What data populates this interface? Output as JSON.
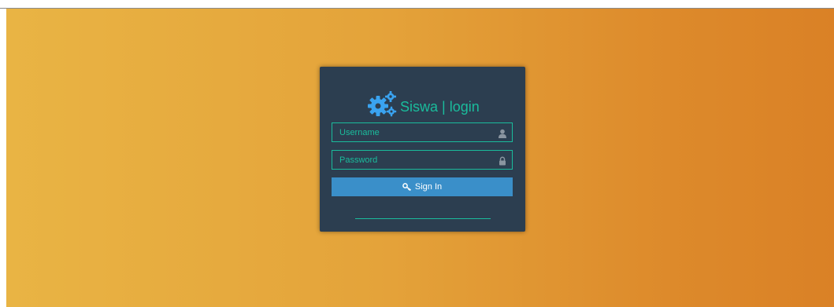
{
  "login": {
    "brand_title": "Siswa | login",
    "username_placeholder": "Username",
    "password_placeholder": "Password",
    "signin_label": "Sign In"
  },
  "colors": {
    "panel": "#2c3e50",
    "accent": "#1abc9c",
    "button": "#3a8fc9",
    "gears": "#3aa3f0",
    "background_start": "#e9b444",
    "background_end": "#da8126"
  },
  "icons": {
    "brand": "gears-icon",
    "username": "user-icon",
    "password": "lock-icon",
    "signin": "key-icon"
  }
}
